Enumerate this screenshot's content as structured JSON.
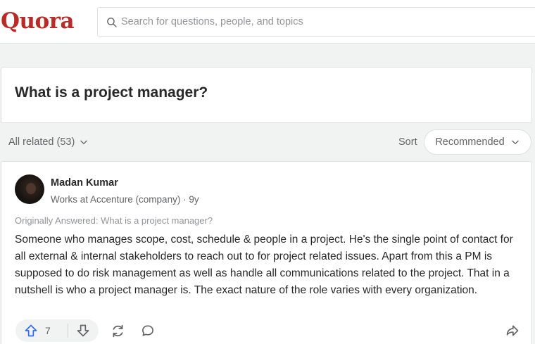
{
  "header": {
    "logo": "Quora",
    "search_placeholder": "Search for questions, people, and topics"
  },
  "question": {
    "title": "What is a project manager?"
  },
  "filters": {
    "related_label": "All related (53)",
    "sort_label": "Sort",
    "sort_value": "Recommended"
  },
  "answer": {
    "author_name": "Madan Kumar",
    "credential": "Works at Accenture (company) · 9y",
    "originally_answered": "Originally Answered: What is a project manager?",
    "text": "Someone who manages scope, cost, schedule & people in a project. He's the single point of contact for all external & internal stakeholders to reach out to for project related issues. Apart from this a PM is supposed to do risk management as well as handle all communications related to the project. That in a nutshell is who a project manager is. The exact nature of the role varies with every organization.",
    "upvotes": "7"
  },
  "icons": [
    "search-icon",
    "chevron-down-icon",
    "upvote-icon",
    "downvote-icon",
    "share-icon",
    "comment-icon",
    "forward-icon"
  ],
  "colors": {
    "brand": "#b92b27",
    "upvote": "#2e69ff",
    "background": "#f1f2f2"
  }
}
